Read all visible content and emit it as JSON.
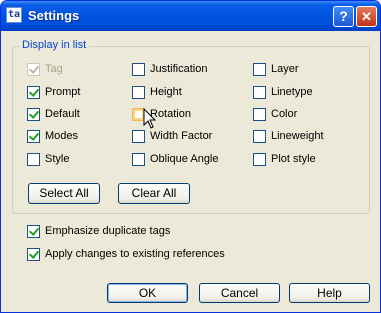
{
  "window": {
    "title": "Settings",
    "help_button": "?",
    "close_button": "✕"
  },
  "display_group": {
    "label": "Display in list",
    "columns": [
      [
        {
          "label": "Tag",
          "checked": true,
          "disabled": true
        },
        {
          "label": "Prompt",
          "checked": true,
          "disabled": false
        },
        {
          "label": "Default",
          "checked": true,
          "disabled": false
        },
        {
          "label": "Modes",
          "checked": true,
          "disabled": false
        },
        {
          "label": "Style",
          "checked": false,
          "disabled": false
        }
      ],
      [
        {
          "label": "Justification",
          "checked": false,
          "disabled": false
        },
        {
          "label": "Height",
          "checked": false,
          "disabled": false
        },
        {
          "label": "Rotation",
          "checked": false,
          "disabled": false,
          "hover": true
        },
        {
          "label": "Width Factor",
          "checked": false,
          "disabled": false
        },
        {
          "label": "Oblique Angle",
          "checked": false,
          "disabled": false
        }
      ],
      [
        {
          "label": "Layer",
          "checked": false,
          "disabled": false
        },
        {
          "label": "Linetype",
          "checked": false,
          "disabled": false
        },
        {
          "label": "Color",
          "checked": false,
          "disabled": false
        },
        {
          "label": "Lineweight",
          "checked": false,
          "disabled": false
        },
        {
          "label": "Plot style",
          "checked": false,
          "disabled": false
        }
      ]
    ],
    "select_all_label": "Select All",
    "clear_all_label": "Clear All"
  },
  "options": {
    "emphasize_label": "Emphasize duplicate tags",
    "emphasize_checked": true,
    "apply_label": "Apply changes to existing references",
    "apply_checked": true
  },
  "footer": {
    "ok_label": "OK",
    "cancel_label": "Cancel",
    "help_label": "Help"
  }
}
